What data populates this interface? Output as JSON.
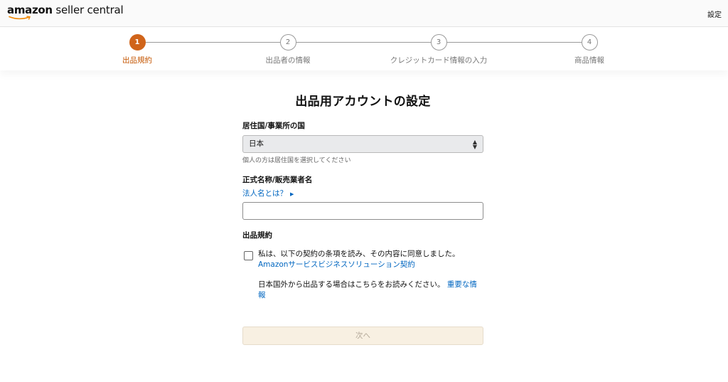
{
  "header": {
    "logo_brand": "amazon",
    "logo_rest": " seller central",
    "settings_label": "設定"
  },
  "steps": [
    {
      "number": "1",
      "label": "出品規約",
      "active": true
    },
    {
      "number": "2",
      "label": "出品者の情報",
      "active": false
    },
    {
      "number": "3",
      "label": "クレジットカード情報の入力",
      "active": false
    },
    {
      "number": "4",
      "label": "商品情報",
      "active": false
    }
  ],
  "form": {
    "title": "出品用アカウントの設定",
    "country": {
      "label": "居住国/事業所の国",
      "selected": "日本",
      "hint": "個人の方は居住国を選択してください"
    },
    "name": {
      "label": "正式名称/販売業者名",
      "help_link": "法人名とは？",
      "value": ""
    },
    "terms": {
      "label": "出品規約",
      "checkbox_text": "私は、以下の契約の条項を読み、その内容に同意しました。",
      "agreement_link": "Amazonサービスビジネスソリューション契約",
      "overseas_note": "日本国外から出品する場合はこちらをお読みください。",
      "important_link": "重要な情報"
    },
    "next_label": "次へ"
  },
  "colors": {
    "accent": "#d0641a",
    "link": "#0066c0",
    "disabled_button_bg": "#f8f0e2"
  }
}
